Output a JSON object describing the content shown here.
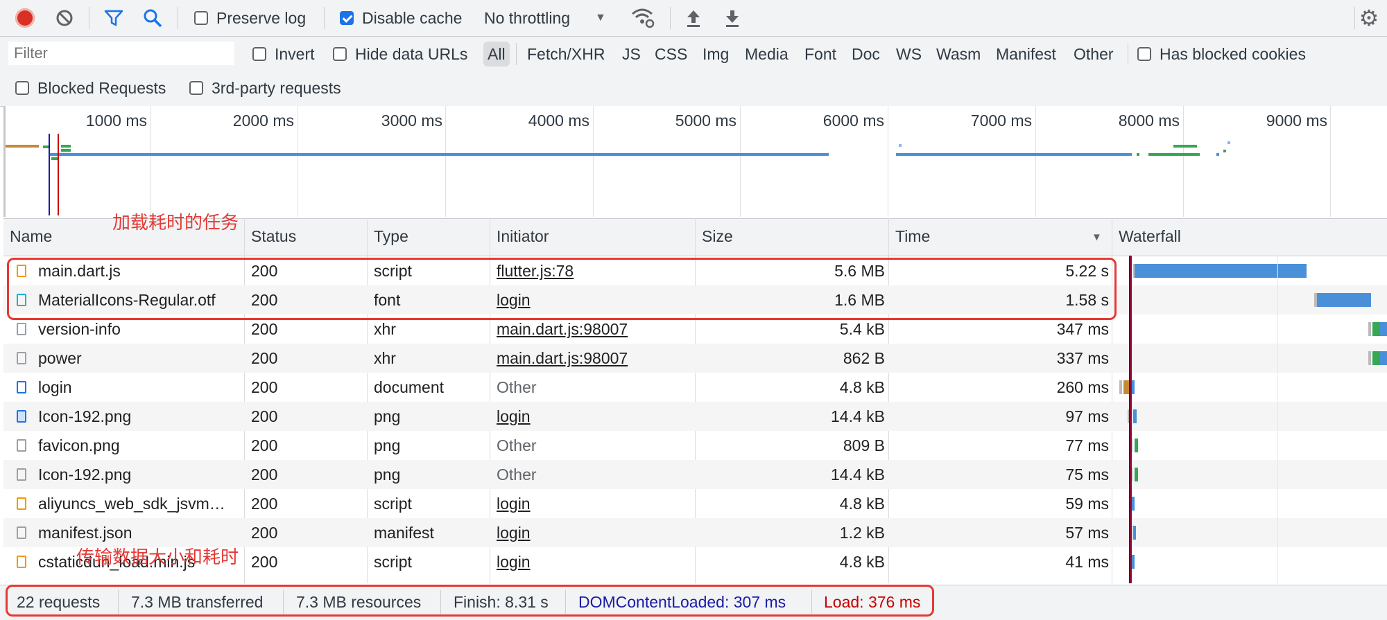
{
  "toolbar": {
    "record_label": "record",
    "preserve_log": "Preserve log",
    "preserve_log_checked": false,
    "disable_cache": "Disable cache",
    "disable_cache_checked": true,
    "throttling": "No throttling",
    "icons": [
      "record-icon",
      "clear-icon",
      "filter-icon",
      "search-icon",
      "network-conditions-icon",
      "import-icon",
      "export-icon",
      "gear-icon"
    ]
  },
  "filter_bar": {
    "placeholder": "Filter",
    "invert": "Invert",
    "hide_data_urls": "Hide data URLs",
    "types": [
      "All",
      "Fetch/XHR",
      "JS",
      "CSS",
      "Img",
      "Media",
      "Font",
      "Doc",
      "WS",
      "Wasm",
      "Manifest",
      "Other"
    ],
    "active_type": "All",
    "has_blocked_cookies": "Has blocked cookies",
    "blocked_requests": "Blocked Requests",
    "third_party": "3rd-party requests"
  },
  "overview": {
    "ticks": [
      "1000 ms",
      "2000 ms",
      "3000 ms",
      "4000 ms",
      "5000 ms",
      "6000 ms",
      "7000 ms",
      "8000 ms",
      "9000 ms"
    ]
  },
  "table": {
    "columns": [
      "Name",
      "Status",
      "Type",
      "Initiator",
      "Size",
      "Time",
      "Waterfall"
    ],
    "sort_column": "Time",
    "rows": [
      {
        "name": "main.dart.js",
        "status": "200",
        "type": "script",
        "initiator": "flutter.js:78",
        "initiator_link": true,
        "size": "5.6 MB",
        "time": "5.22 s",
        "icon": "script"
      },
      {
        "name": "MaterialIcons-Regular.otf",
        "status": "200",
        "type": "font",
        "initiator": "login",
        "initiator_link": true,
        "size": "1.6 MB",
        "time": "1.58 s",
        "icon": "font"
      },
      {
        "name": "version-info",
        "status": "200",
        "type": "xhr",
        "initiator": "main.dart.js:98007",
        "initiator_link": true,
        "size": "5.4 kB",
        "time": "347 ms",
        "icon": "plain"
      },
      {
        "name": "power",
        "status": "200",
        "type": "xhr",
        "initiator": "main.dart.js:98007",
        "initiator_link": true,
        "size": "862 B",
        "time": "337 ms",
        "icon": "plain"
      },
      {
        "name": "login",
        "status": "200",
        "type": "document",
        "initiator": "Other",
        "initiator_link": false,
        "size": "4.8 kB",
        "time": "260 ms",
        "icon": "doc"
      },
      {
        "name": "Icon-192.png",
        "status": "200",
        "type": "png",
        "initiator": "login",
        "initiator_link": true,
        "size": "14.4 kB",
        "time": "97 ms",
        "icon": "img"
      },
      {
        "name": "favicon.png",
        "status": "200",
        "type": "png",
        "initiator": "Other",
        "initiator_link": false,
        "size": "809 B",
        "time": "77 ms",
        "icon": "plain"
      },
      {
        "name": "Icon-192.png",
        "status": "200",
        "type": "png",
        "initiator": "Other",
        "initiator_link": false,
        "size": "14.4 kB",
        "time": "75 ms",
        "icon": "plain"
      },
      {
        "name": "aliyuncs_web_sdk_jsvm…",
        "status": "200",
        "type": "script",
        "initiator": "login",
        "initiator_link": true,
        "size": "4.8 kB",
        "time": "59 ms",
        "icon": "script"
      },
      {
        "name": "manifest.json",
        "status": "200",
        "type": "manifest",
        "initiator": "login",
        "initiator_link": true,
        "size": "1.2 kB",
        "time": "57 ms",
        "icon": "plain"
      },
      {
        "name": "cstaticdun_load.min.js",
        "status": "200",
        "type": "script",
        "initiator": "login",
        "initiator_link": true,
        "size": "4.8 kB",
        "time": "41 ms",
        "icon": "script"
      }
    ]
  },
  "status_bar": {
    "requests": "22 requests",
    "transferred": "7.3 MB transferred",
    "resources": "7.3 MB resources",
    "finish": "Finish: 8.31 s",
    "dom_content_loaded": "DOMContentLoaded: 307 ms",
    "load": "Load: 376 ms",
    "dcl_color": "#1a1aa6",
    "load_color": "#c80000"
  },
  "annotations": {
    "top_note": "加载耗时的任务",
    "bottom_note": "传输数据大小和耗时",
    "color": "#e53935"
  }
}
